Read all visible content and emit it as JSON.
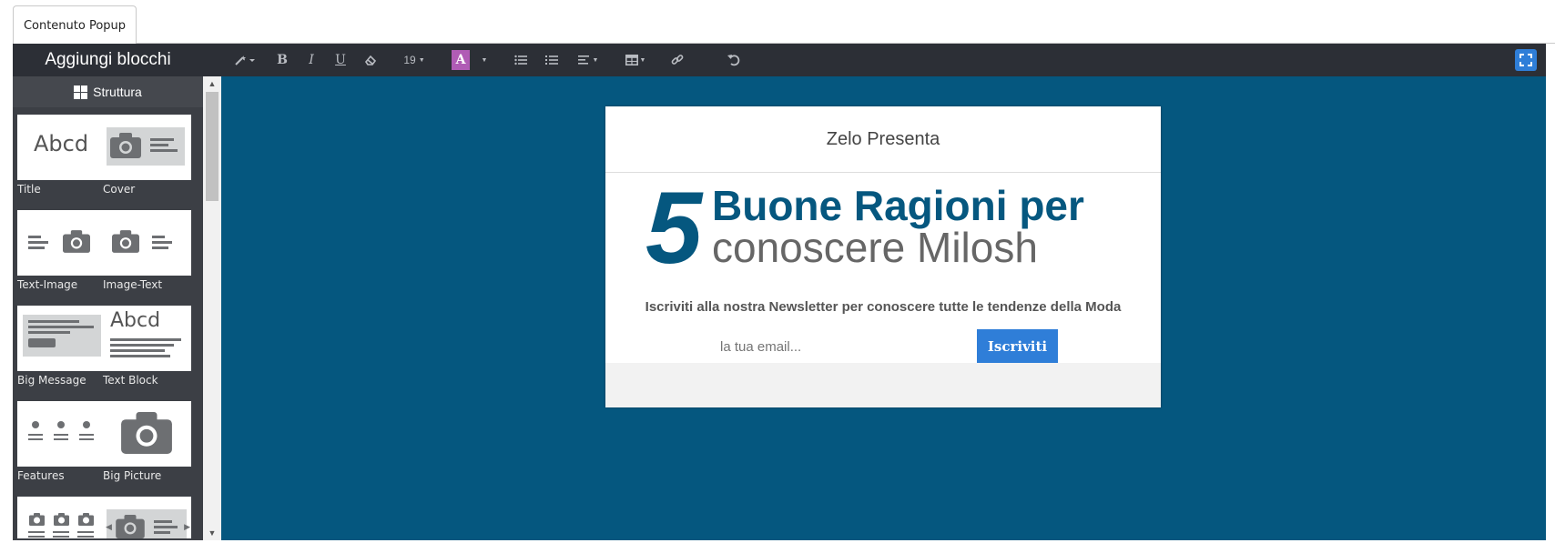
{
  "tab": {
    "label": "Contenuto Popup"
  },
  "sidebar": {
    "title": "Aggiungi blocchi",
    "section": "Struttura",
    "blocks": [
      {
        "label": "Title",
        "thumb_text": "Abcd"
      },
      {
        "label": "Cover"
      },
      {
        "label": "Text-Image"
      },
      {
        "label": "Image-Text"
      },
      {
        "label": "Big Message"
      },
      {
        "label": "Text Block",
        "thumb_text": "Abcd"
      },
      {
        "label": "Features"
      },
      {
        "label": "Big Picture"
      },
      {
        "label": ""
      },
      {
        "label": ""
      }
    ]
  },
  "toolbar": {
    "font_size": "19",
    "color_letter": "A",
    "color_swatch": "#b05cb5"
  },
  "popup": {
    "title": "Zelo Presenta",
    "number": "5",
    "headline_line1": "Buone Ragioni per",
    "headline_line2": "conoscere Milosh",
    "subtext": "Iscriviti alla nostra Newsletter per conoscere tutte le tendenze della Moda",
    "email_placeholder": "la tua email...",
    "subscribe_label": "Iscriviti"
  },
  "colors": {
    "canvas_bg": "#05577f",
    "sidebar_bg": "#3c3f45",
    "toolbar_bg": "#2c2f36",
    "accent": "#2f7ed8",
    "headline_blue": "#05577f"
  }
}
